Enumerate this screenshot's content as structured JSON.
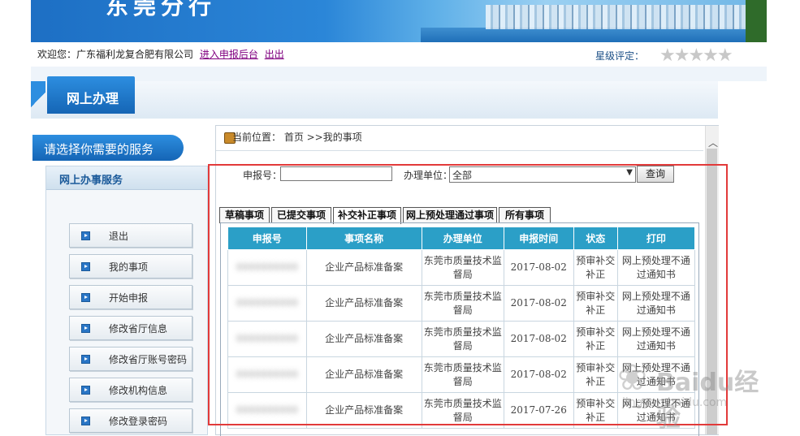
{
  "banner": {
    "title": "东莞分行"
  },
  "welcome": {
    "prefix": "欢迎您：",
    "company": "广东福利龙复合肥有限公司",
    "link_backend": "进入申报后台",
    "link_logout": "出出",
    "rating_label": "星级评定：",
    "stars": "★★★★★",
    "rating_value": 0,
    "rating_max": 5
  },
  "section": {
    "title": "网上办理"
  },
  "sidebar": {
    "header": "请选择你需要的服务",
    "subheader": "网上办事服务",
    "items": [
      {
        "label": "退出"
      },
      {
        "label": "我的事项"
      },
      {
        "label": "开始申报"
      },
      {
        "label": "修改省厅信息"
      },
      {
        "label": "修改省厅账号密码"
      },
      {
        "label": "修改机构信息"
      },
      {
        "label": "修改登录密码"
      }
    ]
  },
  "breadcrumb": {
    "text": "当前位置：  首页 >>我的事项"
  },
  "search": {
    "num_label": "申报号：",
    "num_value": "",
    "unit_label": "办理单位：",
    "unit_value": "全部",
    "query_label": "查询"
  },
  "tabs": [
    {
      "label": "草稿事项",
      "active": false
    },
    {
      "label": "已提交事项",
      "active": false
    },
    {
      "label": "补交补正事项",
      "active": true
    },
    {
      "label": "网上预处理通过事项",
      "active": false
    },
    {
      "label": "所有事项",
      "active": false
    }
  ],
  "table": {
    "headers": [
      "申报号",
      "事项名称",
      "办理单位",
      "申报时间",
      "状态",
      "打印"
    ],
    "rows": [
      {
        "num": "",
        "item": "企业产品标准备案",
        "unit": "东莞市质量技术监督局",
        "date": "2017-08-02",
        "status": "预审补交补正",
        "print": "网上预处理不通过通知书"
      },
      {
        "num": "",
        "item": "企业产品标准备案",
        "unit": "东莞市质量技术监督局",
        "date": "2017-08-02",
        "status": "预审补交补正",
        "print": "网上预处理不通过通知书"
      },
      {
        "num": "",
        "item": "企业产品标准备案",
        "unit": "东莞市质量技术监督局",
        "date": "2017-08-02",
        "status": "预审补交补正",
        "print": "网上预处理不通过通知书"
      },
      {
        "num": "",
        "item": "企业产品标准备案",
        "unit": "东莞市质量技术监督局",
        "date": "2017-08-02",
        "status": "预审补交补正",
        "print": "网上预处理不通过通知书"
      },
      {
        "num": "",
        "item": "企业产品标准备案",
        "unit": "东莞市质量技术监督局",
        "date": "2017-07-26",
        "status": "预审补交补正",
        "print": "网上预处理不通过通知书"
      }
    ]
  },
  "watermark": {
    "brand": "Baidu经验",
    "url": "jingyan.baidu.com"
  },
  "colors": {
    "header_blue": "#2b9fc7",
    "highlight_red": "#e23a3a",
    "link_purple": "#800080"
  }
}
